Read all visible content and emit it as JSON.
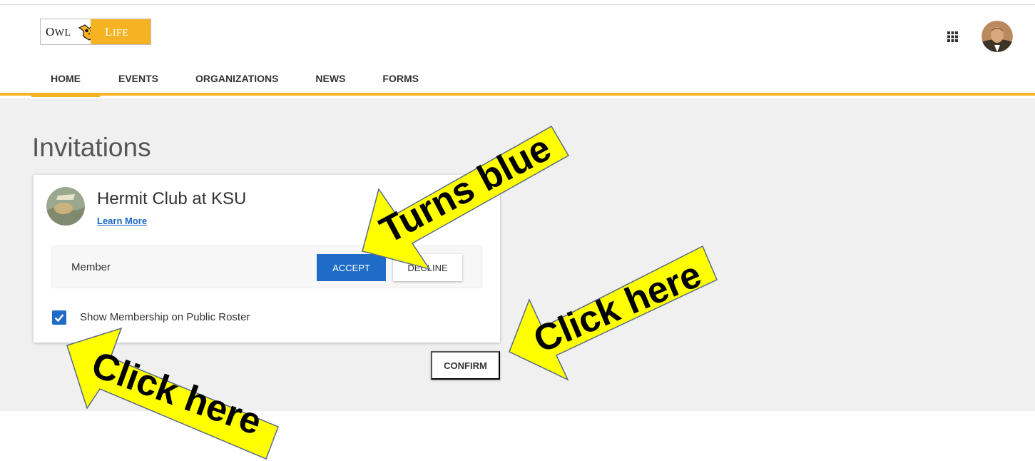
{
  "header": {
    "logo": {
      "text_left_main": "O",
      "text_left_rest": "WL",
      "text_right_main": "L",
      "text_right_rest": "IFE"
    },
    "apps_icon": "grid-icon",
    "avatar_icon": "user-avatar"
  },
  "nav": {
    "items": [
      {
        "label": "HOME",
        "active": true
      },
      {
        "label": "EVENTS",
        "active": false
      },
      {
        "label": "ORGANIZATIONS",
        "active": false
      },
      {
        "label": "NEWS",
        "active": false
      },
      {
        "label": "FORMS",
        "active": false
      }
    ]
  },
  "page": {
    "title": "Invitations"
  },
  "invitation": {
    "org_name": "Hermit Club at KSU",
    "learn_more": "Learn More",
    "role": "Member",
    "accept_label": "ACCEPT",
    "decline_label": "DECLINE",
    "show_membership_label": "Show Membership on Public Roster",
    "show_membership_checked": true
  },
  "confirm_label": "CONFIRM",
  "annotations": {
    "turns_blue": "Turns blue",
    "click_here_1": "Click here",
    "click_here_2": "Click here"
  },
  "colors": {
    "accent_yellow": "#f5b324",
    "primary_blue": "#1e6cc6",
    "arrow_yellow": "#ffff00"
  }
}
